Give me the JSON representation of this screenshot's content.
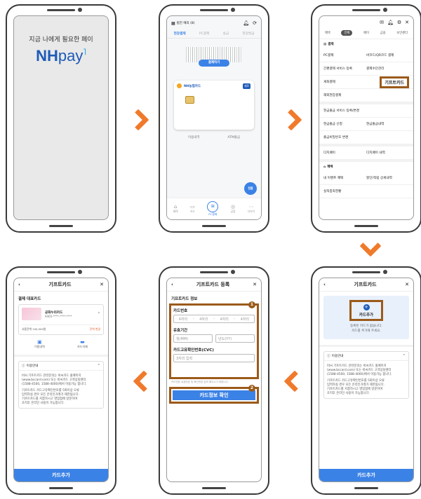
{
  "colors": {
    "accent": "#f07a2c",
    "highlight": "#9b5a1a",
    "blue": "#3b82e6",
    "nh_blue": "#1e5bb8"
  },
  "screen1": {
    "tagline": "지금 나에게 필요한 페이",
    "logo_nh": "NH",
    "logo_pay": "pay"
  },
  "screen2": {
    "top_label": "범진 예의 (8)",
    "tabs": [
      "현장결제",
      "PC결제",
      "송금",
      "현장발급"
    ],
    "pay_button": "결제하기",
    "card_brand": "NH농협카드",
    "card_badge": "세로",
    "card_bottom": [
      "이용내역",
      "ATM출금"
    ],
    "float_btn": "전환",
    "nav": [
      "혜택",
      "카드",
      "PC결제",
      "금융",
      "더보기"
    ]
  },
  "screen3": {
    "tabs": [
      "혜택",
      "전체",
      "페이",
      "금융",
      "보안센터"
    ],
    "section1": "결제",
    "items": [
      [
        "PC결제",
        "바코드/QR코드 결제"
      ],
      [
        "간편결제 서비스 등록",
        "결제수단관리"
      ],
      [
        "게좌결제",
        "기프트카드"
      ],
      [
        "해외현장결제",
        ""
      ]
    ],
    "items2": [
      [
        "현금출금 서비스 등록/변경",
        ""
      ],
      [
        "현금출금 신청",
        "현금출금내역"
      ],
      [
        "출금비밀번호 변경",
        ""
      ]
    ],
    "items3": [
      [
        "디지페이",
        "디지페이 내역"
      ]
    ],
    "section2": "혜택",
    "items4": [
      [
        "내 이벤트 혜택",
        "할인/적립 상세내역"
      ],
      [
        "실적충족현황",
        ""
      ]
    ],
    "highlighted": "기프트카드"
  },
  "screen4": {
    "title": "기프트카드",
    "add_label": "카드추가",
    "empty_text": "등록된 카드가 없습니다.",
    "empty_sub": "카드를 추가해 주세요.",
    "notice_title": "이용안내",
    "notice_lines": [
      "비씨 기프트카드 관련문의는 비씨카드 홈페이지",
      "(www.bccard.com) 또는 비씨카드 고객상담센터",
      "(1588-4500, 1588-4000)에서 이용가능 합니다.",
      "기프트카드 카드고유확인번호를 5회이상 오류",
      "입력하실 경우 모든 온라인거래가 제한됩니다.",
      "기프트카드를 지참하시고 영업점에 방문하여",
      "조치후 온라인 사용이 가능합니다."
    ],
    "add_button": "카드추가"
  },
  "screen5": {
    "title": "기프트카드 등록",
    "section": "기프트카드 정보",
    "card_number_label": "카드번호",
    "card_number_placeholders": [
      "4자리",
      "4자리",
      "4자리",
      "4자리"
    ],
    "expiry_label": "유효기간",
    "month_placeholder": "월(MM)",
    "year_placeholder": "년도(YY)",
    "cvc_label": "카드고유확인번호(CVC)",
    "cvc_placeholder": "3자리 입력",
    "hint": "카드번호 유효번호 및 확인번호 입력 해주시기 바랍니다.",
    "confirm_button": "카드정보 확인",
    "step1": "1",
    "step2": "2"
  },
  "screen6": {
    "title": "기프트카드",
    "section": "결제 대표카드",
    "card_name": "공화누리카드",
    "card_number": "9465-****-****-****",
    "balance_label": "사용잔액 100,000원",
    "balance_link": "잔액 변경",
    "actions": [
      "이용내역",
      "카드삭제"
    ],
    "notice_title": "이용안내",
    "notice_lines": [
      "비씨 기프트카드 관련문의는 비씨카드 홈페이지",
      "(www.bccard.com) 또는 비씨카드 고객상담센터",
      "(1588-4500, 1588-4000)에서 이용가능 합니다.",
      "기프트카드 카드고유확인번호를 5회이상 오류",
      "입력하실 경우 모든 온라인거래가 제한됩니다.",
      "기프트카드를 지참하시고 영업점에 방문하여",
      "조치후 온라인 사용이 가능합니다."
    ],
    "add_button": "카드추가"
  }
}
